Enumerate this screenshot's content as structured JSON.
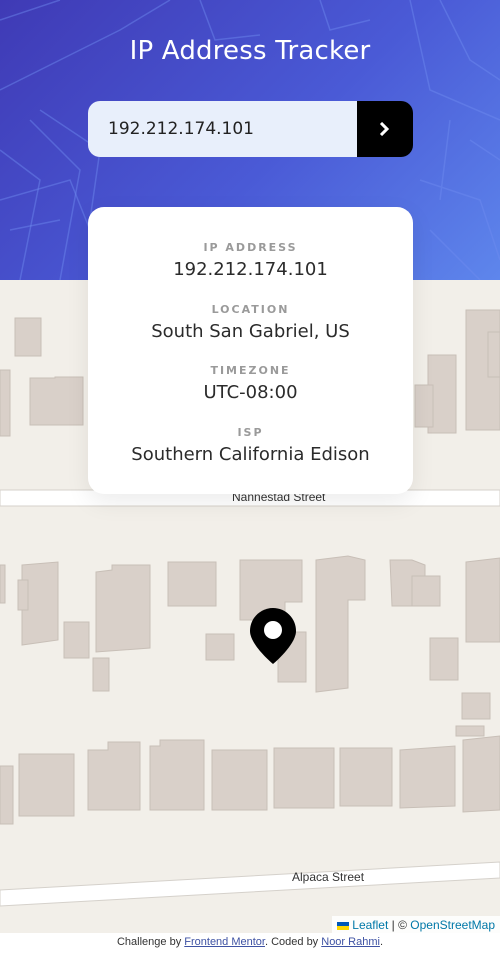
{
  "header": {
    "title": "IP Address Tracker"
  },
  "search": {
    "value": "192.212.174.101",
    "button_icon": "chevron-right-icon"
  },
  "info": [
    {
      "label": "IP Address",
      "value": "192.212.174.101"
    },
    {
      "label": "Location",
      "value": "South San Gabriel, US"
    },
    {
      "label": "Timezone",
      "value": "UTC-08:00"
    },
    {
      "label": "ISP",
      "value": "Southern California Edison"
    }
  ],
  "map": {
    "streets": [
      "Nannestad Street",
      "Alpaca Street"
    ],
    "marker_icon": "location-pin-icon",
    "attribution": {
      "leaflet": "Leaflet",
      "separator": " | © ",
      "osm": "OpenStreetMap"
    }
  },
  "footer": {
    "prefix": "Challenge by ",
    "challenge_link": "Frontend Mentor",
    "middle": ". Coded by ",
    "author_link": "Noor Rahmi",
    "suffix": "."
  },
  "colors": {
    "hero_gradient_start": "#3f3ab5",
    "hero_gradient_end": "#5e86ec",
    "map_background": "#f2efe9",
    "building": "#d9d0c9",
    "link": "#0078a8"
  }
}
